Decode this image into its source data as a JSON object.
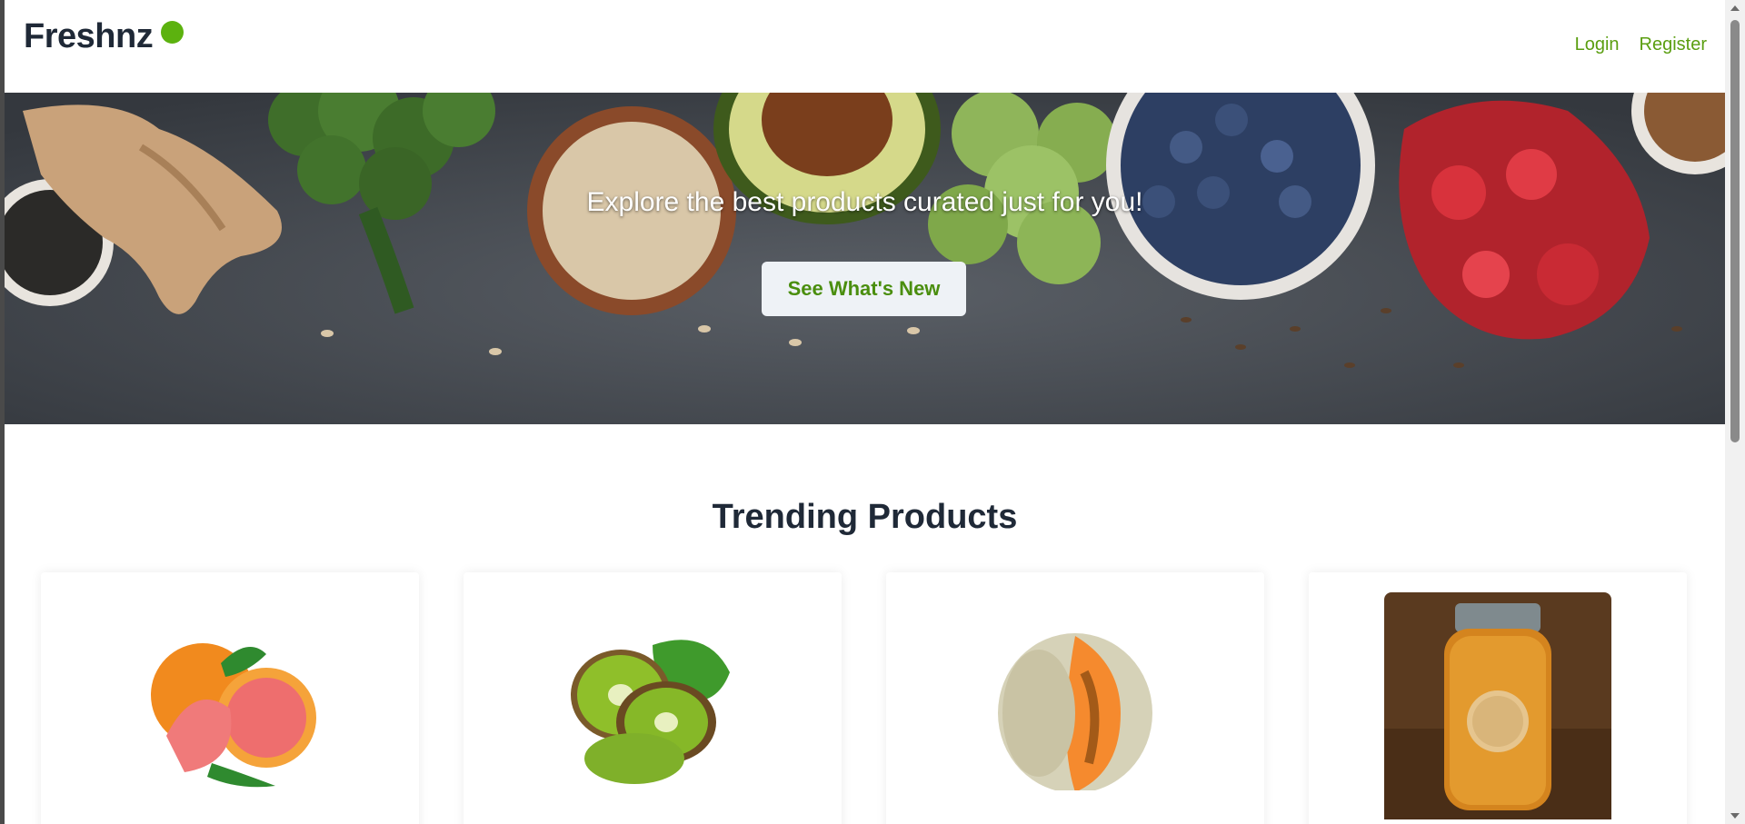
{
  "header": {
    "brand": "Freshnz",
    "brand_color": "#5cb20f",
    "nav": {
      "login": "Login",
      "register": "Register"
    }
  },
  "hero": {
    "tagline": "Explore the best products curated just for you!",
    "cta": "See What's New"
  },
  "trending": {
    "title": "Trending Products",
    "products": [
      {
        "image": "grapefruit-image"
      },
      {
        "image": "kiwi-image"
      },
      {
        "image": "cantaloupe-image"
      },
      {
        "image": "honey-jar-image"
      }
    ]
  },
  "colors": {
    "accent": "#5cb20f",
    "link": "#5a9e10",
    "heading": "#1f2937"
  }
}
